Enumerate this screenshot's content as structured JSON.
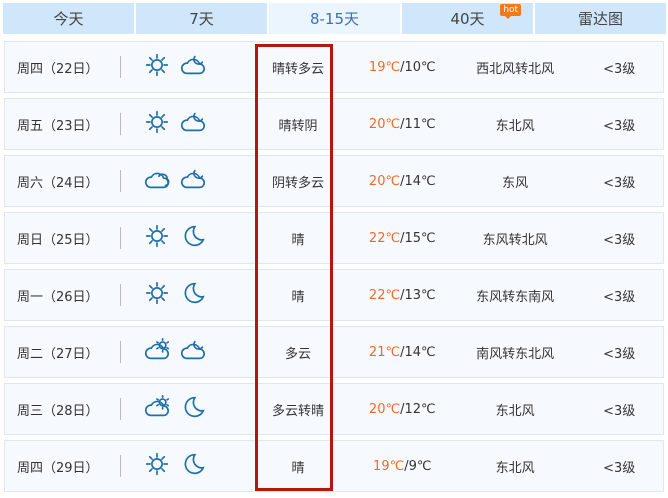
{
  "tabs": [
    {
      "label": "今天"
    },
    {
      "label": "7天"
    },
    {
      "label": "8-15天"
    },
    {
      "label": "40天",
      "badge": "hot"
    },
    {
      "label": "雷达图"
    }
  ],
  "active_tab": "8-15天",
  "days": [
    {
      "date": "周四（22日）",
      "icons": [
        "sun",
        "cloud-moon"
      ],
      "desc": "晴转多云",
      "high": "19℃",
      "low": "/10℃",
      "wind": "西北风转北风",
      "level": "<3级"
    },
    {
      "date": "周五（23日）",
      "icons": [
        "sun",
        "cloud-moon"
      ],
      "desc": "晴转阴",
      "high": "20℃",
      "low": "/11℃",
      "wind": "东北风",
      "level": "<3级"
    },
    {
      "date": "周六（24日）",
      "icons": [
        "cloud",
        "cloud-moon"
      ],
      "desc": "阴转多云",
      "high": "20℃",
      "low": "/14℃",
      "wind": "东风",
      "level": "<3级"
    },
    {
      "date": "周日（25日）",
      "icons": [
        "sun",
        "moon"
      ],
      "desc": "晴",
      "high": "22℃",
      "low": "/15℃",
      "wind": "东风转北风",
      "level": "<3级"
    },
    {
      "date": "周一（26日）",
      "icons": [
        "sun",
        "moon"
      ],
      "desc": "晴",
      "high": "22℃",
      "low": "/13℃",
      "wind": "东风转东南风",
      "level": "<3级"
    },
    {
      "date": "周二（27日）",
      "icons": [
        "sun-cloud",
        "cloud-moon"
      ],
      "desc": "多云",
      "high": "21℃",
      "low": "/14℃",
      "wind": "南风转东北风",
      "level": "<3级"
    },
    {
      "date": "周三（28日）",
      "icons": [
        "sun-cloud",
        "moon"
      ],
      "desc": "多云转晴",
      "high": "20℃",
      "low": "/12℃",
      "wind": "东北风",
      "level": "<3级"
    },
    {
      "date": "周四（29日）",
      "icons": [
        "sun",
        "moon"
      ],
      "desc": "晴",
      "high": "19℃",
      "low": "/9℃",
      "wind": "东北风",
      "level": "<3级"
    }
  ],
  "colors": {
    "highlight_box": "#b5160e",
    "high_temp": "#f0682a",
    "icon": "#1f6fa8"
  }
}
